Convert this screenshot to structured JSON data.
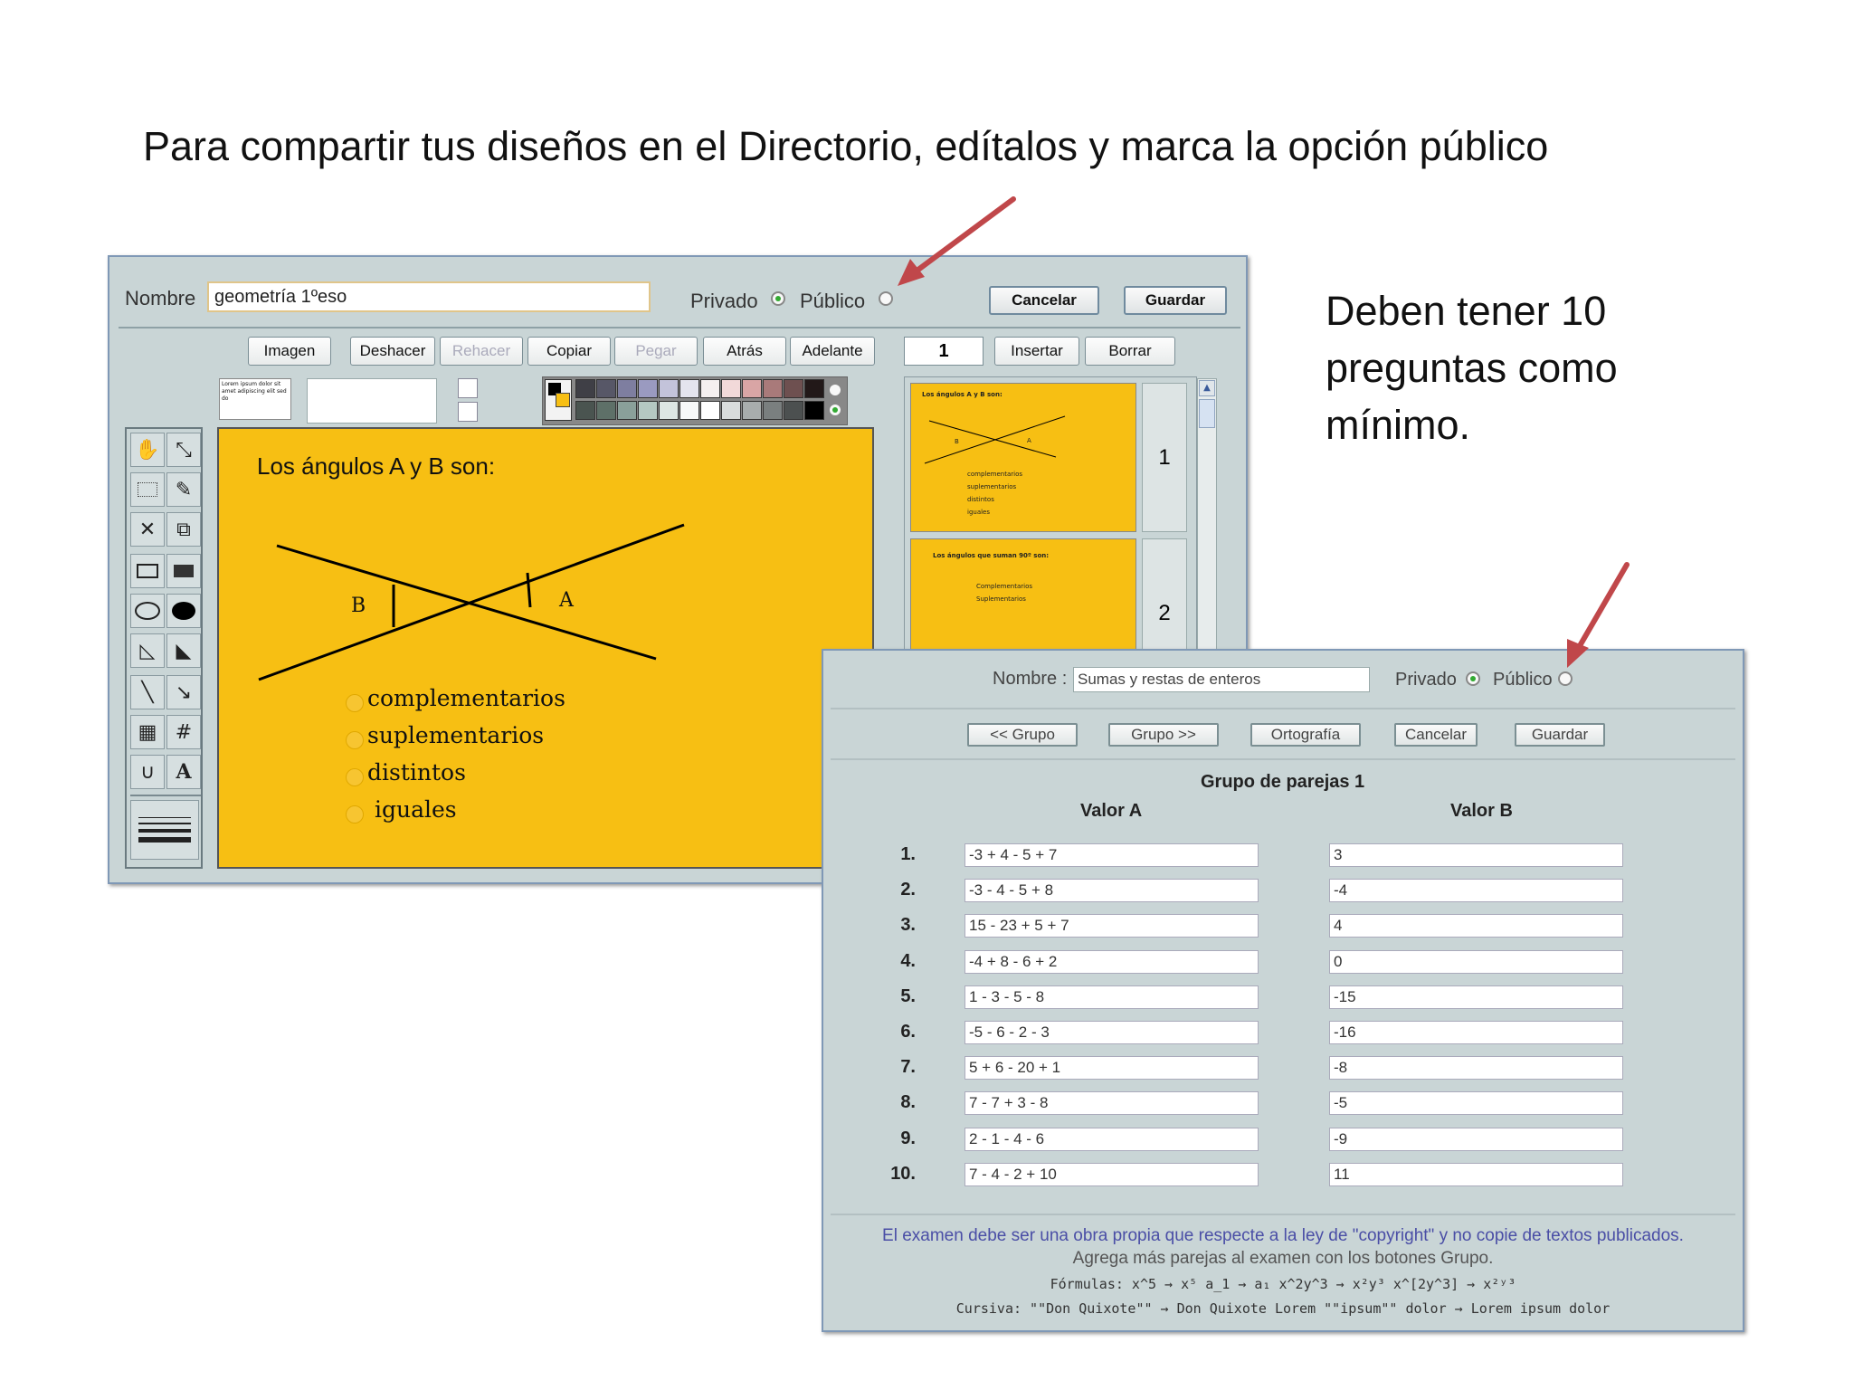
{
  "slide": {
    "title": "Para compartir tus diseños en el Directorio, edítalos y marca la opción público",
    "side_note": "Deben tener 10 preguntas como mínimo.",
    "colors": {
      "arrow": "#c0474a",
      "canvas": "#f7bf13",
      "window_bg": "#c9d5d6"
    }
  },
  "editor": {
    "name_label": "Nombre",
    "name_value": "geometría 1ºeso",
    "privado_label": "Privado",
    "publico_label": "Público",
    "privado_selected": true,
    "cancel_label": "Cancelar",
    "save_label": "Guardar",
    "toolbar": {
      "imagen": "Imagen",
      "deshacer": "Deshacer",
      "rehacer": "Rehacer",
      "copiar": "Copiar",
      "pegar": "Pegar",
      "atras": "Atrás",
      "adelante": "Adelante",
      "slide_number": "1",
      "insertar": "Insertar",
      "borrar": "Borrar"
    },
    "font_sample": "Lorem ipsum dolor sit amet adipiscing elit sed do",
    "tools": [
      "hand-icon",
      "resize-icon",
      "select-rect-icon",
      "fill-icon",
      "delete-icon",
      "copy-icon",
      "rect-outline-icon",
      "rect-filled-icon",
      "ellipse-outline-icon",
      "ellipse-filled-icon",
      "triangle-outline-icon",
      "triangle-filled-icon",
      "line-icon",
      "arrow-line-icon",
      "table-icon",
      "grid-icon",
      "curve-icon",
      "text-icon"
    ],
    "canvas": {
      "question": "Los ángulos A y B son:",
      "label_a": "A",
      "label_b": "B",
      "options": [
        "complementarios",
        "suplementarios",
        "distintos",
        "iguales"
      ]
    },
    "thumbnails": [
      {
        "number": "1",
        "title": "Los ángulos A y B son:",
        "options": [
          "complementarios",
          "suplementarios",
          "distintos",
          "iguales"
        ],
        "label_a": "A",
        "label_b": "B"
      },
      {
        "number": "2",
        "title": "Los ángulos que suman 90º son:",
        "options": [
          "Complementarios",
          "Suplementarios"
        ]
      }
    ]
  },
  "pairs": {
    "name_label": "Nombre :",
    "name_value": "Sumas y restas de enteros",
    "privado_label": "Privado",
    "publico_label": "Público",
    "prev_group": "<< Grupo",
    "next_group": "Grupo >>",
    "ortografia": "Ortografía",
    "cancel": "Cancelar",
    "save": "Guardar",
    "group_title": "Grupo de parejas 1",
    "col_a": "Valor A",
    "col_b": "Valor B",
    "rows": [
      {
        "n": "1.",
        "a": "-3 + 4 - 5 + 7",
        "b": "3"
      },
      {
        "n": "2.",
        "a": "-3 - 4 - 5 + 8",
        "b": "-4"
      },
      {
        "n": "3.",
        "a": "15 - 23 + 5 + 7",
        "b": "4"
      },
      {
        "n": "4.",
        "a": "-4 + 8 - 6 + 2",
        "b": "0"
      },
      {
        "n": "5.",
        "a": "1 - 3 - 5 - 8",
        "b": "-15"
      },
      {
        "n": "6.",
        "a": "-5 - 6 - 2 - 3",
        "b": "-16"
      },
      {
        "n": "7.",
        "a": "5 + 6 - 20 + 1",
        "b": "-8"
      },
      {
        "n": "8.",
        "a": "7 - 7 + 3 - 8",
        "b": "-5"
      },
      {
        "n": "9.",
        "a": "2 - 1 - 4 - 6",
        "b": "-9"
      },
      {
        "n": "10.",
        "a": "7 - 4 - 2 + 10",
        "b": "11"
      }
    ],
    "footer_line1": "El examen debe ser una obra propia que respecte a la ley de \"copyright\" y no copie de textos publicados.",
    "footer_line2": "Agrega más parejas al examen con los botones Grupo.",
    "footer_formulas": "Fórmulas: x^5 → x⁵   a_1 → a₁   x^2y^3 → x²y³   x^[2y^3] → x²ʸ³",
    "footer_cursiva": "Cursiva: \"\"Don Quixote\"\" → Don Quixote   Lorem \"\"ipsum\"\" dolor → Lorem ipsum dolor"
  }
}
